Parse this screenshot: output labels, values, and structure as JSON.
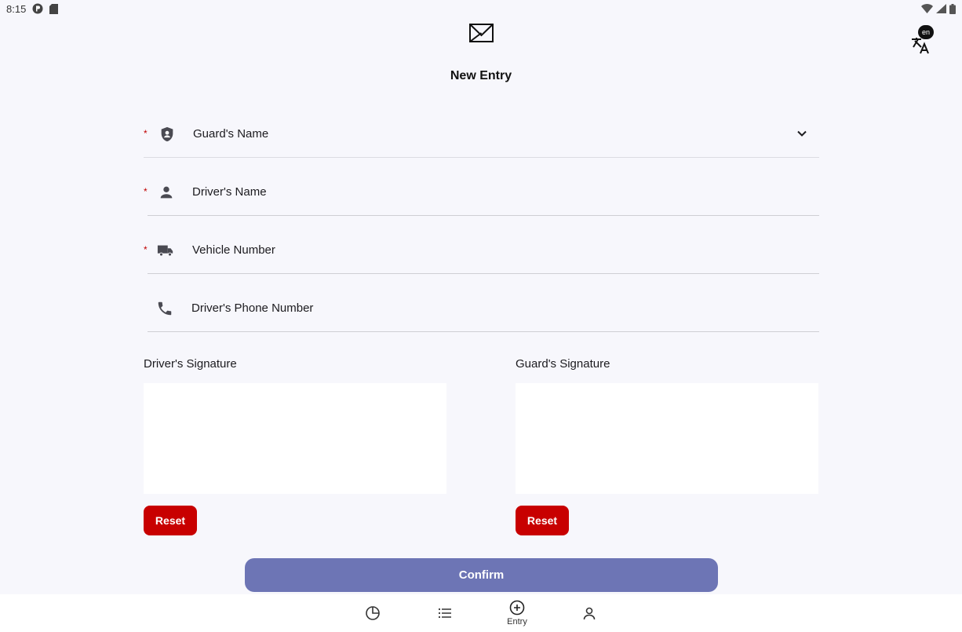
{
  "status_bar": {
    "time": "8:15"
  },
  "header": {
    "title": "New Entry",
    "language_badge": "en"
  },
  "form": {
    "fields": [
      {
        "label": "Guard's Name",
        "required": true,
        "icon": "shield-person-icon",
        "type": "dropdown"
      },
      {
        "label": "Driver's Name",
        "required": true,
        "icon": "person-icon",
        "type": "text"
      },
      {
        "label": "Vehicle Number",
        "required": true,
        "icon": "truck-icon",
        "type": "text"
      },
      {
        "label": "Driver's Phone Number",
        "required": false,
        "icon": "phone-icon",
        "type": "text"
      }
    ],
    "required_marker": "*"
  },
  "signatures": {
    "driver": {
      "label": "Driver's Signature",
      "reset_label": "Reset"
    },
    "guard": {
      "label": "Guard's Signature",
      "reset_label": "Reset"
    }
  },
  "actions": {
    "confirm_label": "Confirm"
  },
  "bottom_nav": {
    "items": [
      {
        "icon": "pie-chart-icon",
        "label": ""
      },
      {
        "icon": "list-icon",
        "label": ""
      },
      {
        "icon": "add-circle-icon",
        "label": "Entry",
        "active": true
      },
      {
        "icon": "profile-icon",
        "label": ""
      }
    ]
  },
  "colors": {
    "background": "#f7f7fc",
    "required": "#c00000",
    "reset": "#c80000",
    "confirm": "#6d75b5"
  }
}
